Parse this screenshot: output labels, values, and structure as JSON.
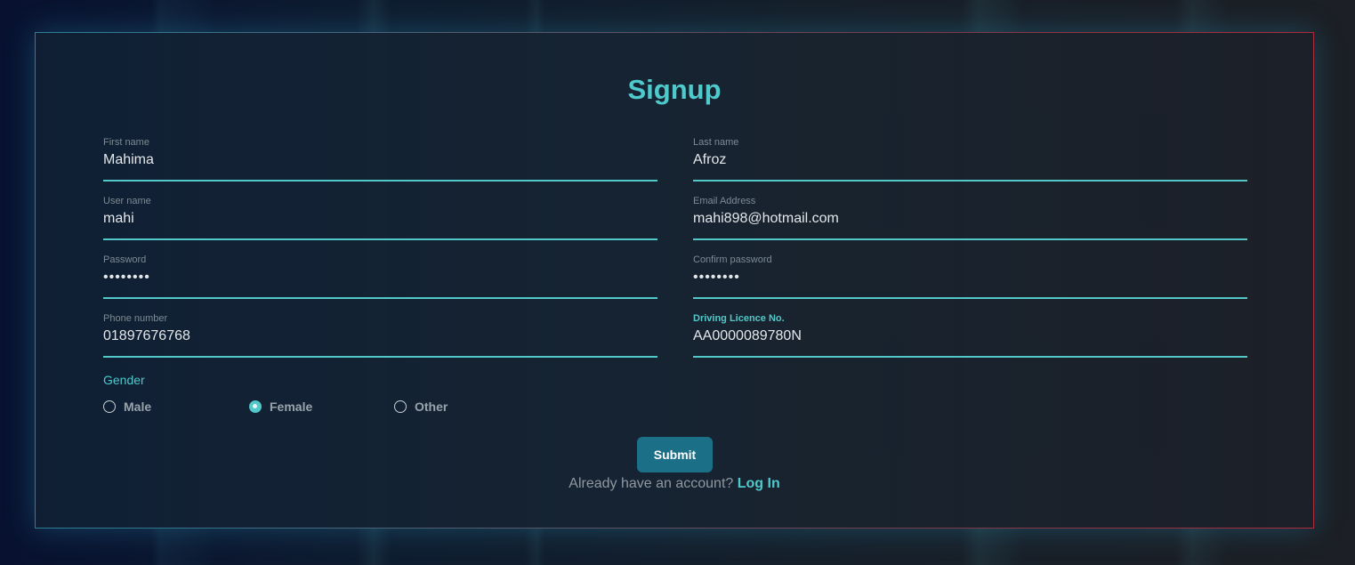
{
  "form": {
    "title": "Signup",
    "fields": {
      "first_name": {
        "label": "First name",
        "value": "Mahima"
      },
      "last_name": {
        "label": "Last name",
        "value": "Afroz"
      },
      "user_name": {
        "label": "User name",
        "value": "mahi"
      },
      "email": {
        "label": "Email Address",
        "value": "mahi898@hotmail.com"
      },
      "password": {
        "label": "Password",
        "value": "••••••••"
      },
      "confirm_password": {
        "label": "Confirm password",
        "value": "••••••••"
      },
      "phone": {
        "label": "Phone number",
        "value": "01897676768"
      },
      "driving_licence": {
        "label": "Driving Licence No.",
        "value": "AA0000089780N"
      }
    },
    "gender": {
      "label": "Gender",
      "options": [
        "Male",
        "Female",
        "Other"
      ],
      "selected": "Female"
    },
    "submit_label": "Submit",
    "login_prompt": "Already have an account?",
    "login_link": "Log In"
  },
  "colors": {
    "accent": "#52c8c9",
    "button": "#1b6f87"
  }
}
